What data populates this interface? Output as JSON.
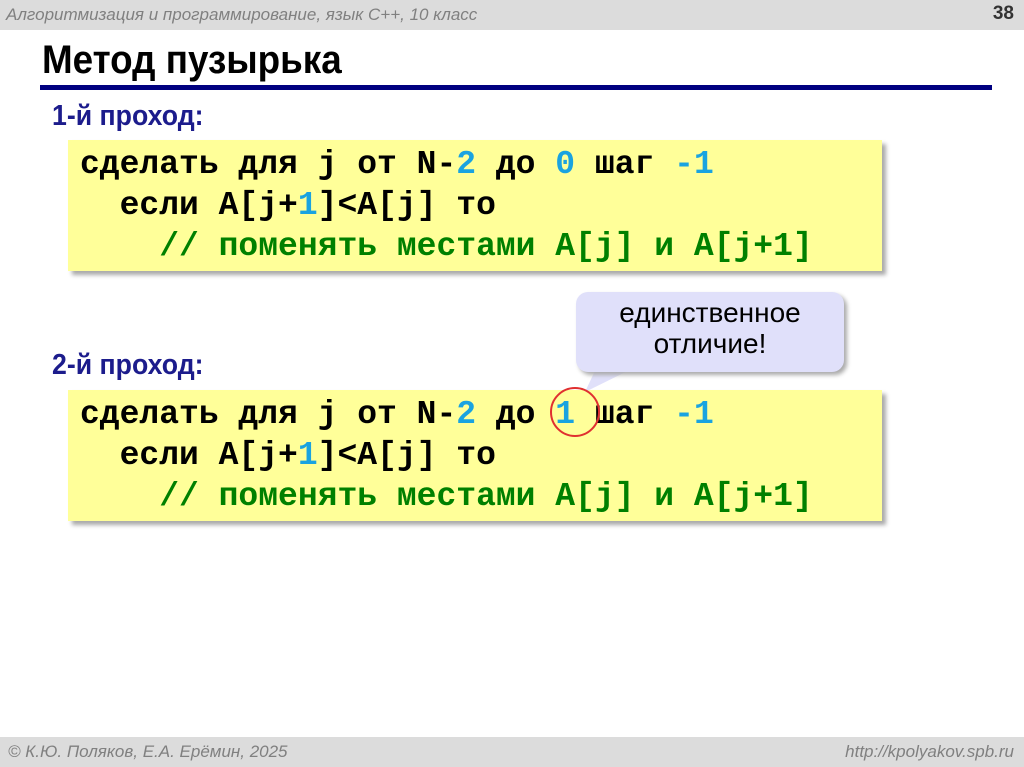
{
  "header": {
    "course": "Алгоритмизация и программирование, язык С++, 10 класс",
    "page": "38"
  },
  "title": "Метод пузырька",
  "passes": [
    {
      "label": "1-й проход:",
      "lines": [
        [
          {
            "t": "сделать для j от N-",
            "c": "k"
          },
          {
            "t": "2",
            "c": "n"
          },
          {
            "t": " до ",
            "c": "k"
          },
          {
            "t": "0",
            "c": "n"
          },
          {
            "t": " шаг ",
            "c": "k"
          },
          {
            "t": "-1",
            "c": "n"
          }
        ],
        [
          {
            "t": "  если A[j+",
            "c": "k"
          },
          {
            "t": "1",
            "c": "n"
          },
          {
            "t": "]<A[j] то",
            "c": "k"
          }
        ],
        [
          {
            "t": "    // поменять местами A[j] и A[j+1]",
            "c": "c"
          }
        ]
      ]
    },
    {
      "label": "2-й проход:",
      "lines": [
        [
          {
            "t": "сделать для j от N-",
            "c": "k"
          },
          {
            "t": "2",
            "c": "n"
          },
          {
            "t": " до ",
            "c": "k"
          },
          {
            "t": "1",
            "c": "n"
          },
          {
            "t": " шаг ",
            "c": "k"
          },
          {
            "t": "-1",
            "c": "n"
          }
        ],
        [
          {
            "t": "  если A[j+",
            "c": "k"
          },
          {
            "t": "1",
            "c": "n"
          },
          {
            "t": "]<A[j] то",
            "c": "k"
          }
        ],
        [
          {
            "t": "    // поменять местами A[j] и A[j+1]",
            "c": "c"
          }
        ]
      ]
    }
  ],
  "callout": {
    "line1": "единственное",
    "line2": "отличие!"
  },
  "footer": {
    "left": "© К.Ю. Поляков, Е.А. Ерёмин, 2025",
    "right": "http://kpolyakov.spb.ru"
  }
}
